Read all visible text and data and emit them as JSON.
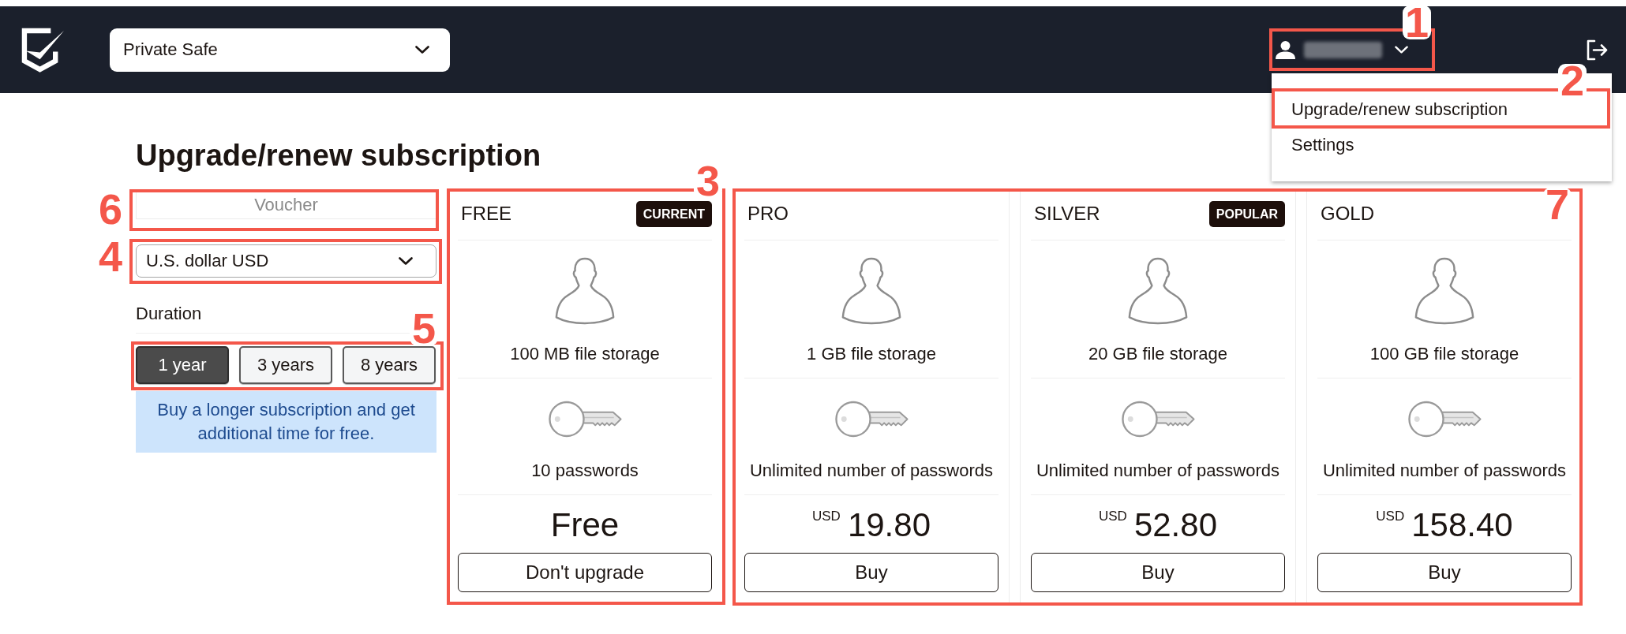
{
  "header": {
    "safe_select": {
      "value": "Private Safe"
    },
    "user_menu": {
      "expanded": true,
      "callout": "1",
      "items": [
        {
          "label": "Upgrade/renew subscription",
          "callout": "2"
        },
        {
          "label": "Settings"
        }
      ]
    }
  },
  "page_title": "Upgrade/renew subscription",
  "voucher": {
    "placeholder": "Voucher",
    "callout": "6"
  },
  "currency": {
    "value": "U.S. dollar USD",
    "callout": "4"
  },
  "duration": {
    "label": "Duration",
    "callout": "5",
    "options": [
      {
        "label": "1 year",
        "selected": true
      },
      {
        "label": "3 years",
        "selected": false
      },
      {
        "label": "8 years",
        "selected": false
      }
    ]
  },
  "info": "Buy a longer subscription and get additional time for free.",
  "plan_groups": [
    {
      "callout": "3",
      "plans": [
        {
          "name": "FREE",
          "badge": "CURRENT",
          "features": [
            {
              "kind": "storage",
              "text": "100 MB file storage"
            },
            {
              "kind": "passwords",
              "text": "10 passwords"
            }
          ],
          "price": {
            "amount": "Free"
          },
          "button": "Don't upgrade"
        }
      ]
    },
    {
      "callout": "7",
      "plans": [
        {
          "name": "PRO",
          "features": [
            {
              "kind": "storage",
              "text": "1 GB file storage"
            },
            {
              "kind": "passwords",
              "text": "Unlimited number of passwords"
            }
          ],
          "price": {
            "currency": "USD",
            "amount": "19.80"
          },
          "button": "Buy"
        },
        {
          "name": "SILVER",
          "badge": "POPULAR",
          "features": [
            {
              "kind": "storage",
              "text": "20 GB file storage"
            },
            {
              "kind": "passwords",
              "text": "Unlimited number of passwords"
            }
          ],
          "price": {
            "currency": "USD",
            "amount": "52.80"
          },
          "button": "Buy"
        },
        {
          "name": "GOLD",
          "features": [
            {
              "kind": "storage",
              "text": "100 GB file storage"
            },
            {
              "kind": "passwords",
              "text": "Unlimited number of passwords"
            }
          ],
          "price": {
            "currency": "USD",
            "amount": "158.40"
          },
          "button": "Buy"
        }
      ]
    }
  ]
}
